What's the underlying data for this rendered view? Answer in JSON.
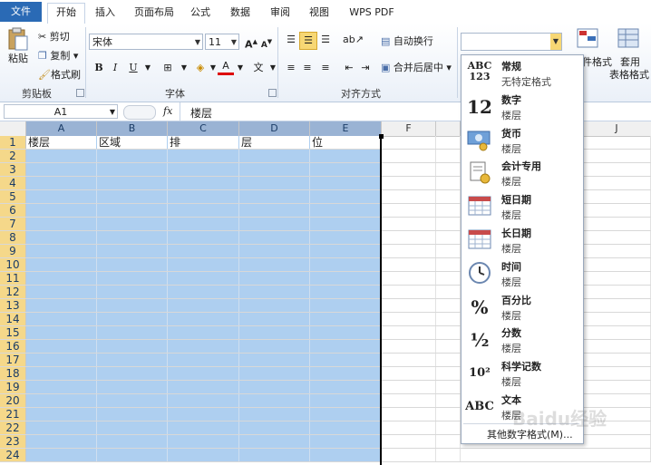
{
  "tabs": [
    "文件",
    "开始",
    "插入",
    "页面布局",
    "公式",
    "数据",
    "审阅",
    "视图",
    "WPS PDF"
  ],
  "clipboard": {
    "paste": "粘贴",
    "cut": "剪切",
    "copy": "复制",
    "format_painter": "格式刷",
    "label": "剪贴板"
  },
  "font": {
    "name": "宋体",
    "size": "11",
    "bold": "B",
    "italic": "I",
    "underline": "U",
    "label": "字体",
    "wen": "文",
    "color_a": "A"
  },
  "align": {
    "wrap": "自动换行",
    "merge": "合并后居中",
    "label": "对齐方式"
  },
  "styles": {
    "cond_format": "件格式",
    "table_format": "套用",
    "table_format2": "表格格式"
  },
  "formula_bar": {
    "name_box": "A1",
    "fx": "fx",
    "content": "楼层"
  },
  "columns": [
    "A",
    "B",
    "C",
    "D",
    "E",
    "F",
    "J"
  ],
  "header_row": [
    "楼层",
    "区域",
    "排",
    "层",
    "位"
  ],
  "row_numbers": [
    "1",
    "2",
    "3",
    "4",
    "5",
    "6",
    "7",
    "8",
    "9",
    "10",
    "11",
    "12",
    "13",
    "14",
    "15",
    "16",
    "17",
    "18",
    "19",
    "20",
    "21",
    "22",
    "23",
    "24"
  ],
  "number_formats": [
    {
      "icon": "ABC\n123",
      "name": "常规",
      "sample": "无特定格式"
    },
    {
      "icon": "12",
      "name": "数字",
      "sample": "楼层"
    },
    {
      "icon": "currency-icon",
      "name": "货币",
      "sample": "楼层"
    },
    {
      "icon": "accounting-icon",
      "name": "会计专用",
      "sample": "楼层"
    },
    {
      "icon": "calendar-icon",
      "name": "短日期",
      "sample": "楼层"
    },
    {
      "icon": "calendar-icon",
      "name": "长日期",
      "sample": "楼层"
    },
    {
      "icon": "clock-icon",
      "name": "时间",
      "sample": "楼层"
    },
    {
      "icon": "%",
      "name": "百分比",
      "sample": "楼层"
    },
    {
      "icon": "½",
      "name": "分数",
      "sample": "楼层"
    },
    {
      "icon": "10²",
      "name": "科学记数",
      "sample": "楼层"
    },
    {
      "icon": "ABC",
      "name": "文本",
      "sample": "楼层"
    }
  ],
  "more_formats": "其他数字格式(M)...",
  "watermark": "Baidu经验"
}
